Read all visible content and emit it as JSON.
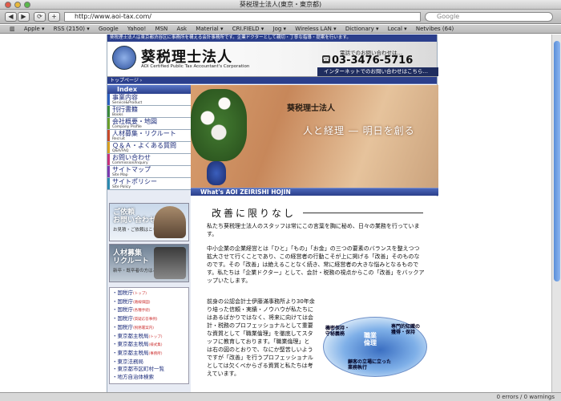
{
  "window": {
    "title": "葵税理士法人(東京・東京都)"
  },
  "toolbar": {
    "back_label": "◀",
    "forward_label": "▶",
    "refresh_label": "⟳",
    "add_label": "+",
    "url": "http://www.aoi-tax.com/",
    "search_placeholder": "Google"
  },
  "bookmarks": [
    "Apple ▾",
    "RSS (2150) ▾",
    "Google",
    "Yahoo!",
    "MSN",
    "Ask",
    "Material ▾",
    "CRI.FIELD ▾",
    "Jog ▾",
    "Wireless LAN ▾",
    "Dictionary ▾",
    "Local ▾",
    "Netvibes (64)"
  ],
  "site": {
    "topbar_text": "葵税理士法人は東京都渋谷区に事務所を構える会計事務所です。企業ドクターとして親切・丁寧な指導・提案を行います。",
    "logo_name": "葵税理士法人",
    "logo_sub": "AOI Certified Public Tax Accountant's Corporation",
    "phone_label": "電話でのお問い合わせは…",
    "phone_number": "03-3476-5716",
    "inquiry_text": "インターネットでのお問い合わせはこちら…",
    "breadcrumb": "トップページ ›",
    "index_label": "Index",
    "menu": [
      {
        "jp": "事業内容",
        "en": "Service&Product",
        "color": "#2b5fbf"
      },
      {
        "jp": "刊行書籍",
        "en": "Books",
        "color": "#3a8a3a"
      },
      {
        "jp": "会社概要・地図",
        "en": "Company Profile",
        "color": "#6a9e2a"
      },
      {
        "jp": "人材募集・リクルート",
        "en": "Recruit",
        "color": "#c84a2a"
      },
      {
        "jp": "Ｑ＆Ａ・よくある質問",
        "en": "Q&A/FAQ",
        "color": "#d8a020"
      },
      {
        "jp": "お問い合わせ",
        "en": "Commission/Inquiry",
        "color": "#c8307a"
      },
      {
        "jp": "サイトマップ",
        "en": "Site Map",
        "color": "#7a3ab0"
      },
      {
        "jp": "サイトポリシー",
        "en": "Site Policy",
        "color": "#2b8ab0"
      }
    ],
    "banner1": {
      "title_line1": "ご依頼",
      "title_line2": "お問い合わせ",
      "sub": "お見積・ご依頼はこちら"
    },
    "banner2": {
      "title_line1": "人材募集",
      "title_line2": "リクルート",
      "sub": "新卒・既卒者の方はこちら"
    },
    "links": [
      {
        "text": "・国税庁",
        "note": "(トップ)"
      },
      {
        "text": "・国税庁",
        "note": "(路線価図)"
      },
      {
        "text": "・国税庁",
        "note": "(各種手続)"
      },
      {
        "text": "・国税庁",
        "note": "(質疑応答事例)"
      },
      {
        "text": "・国税庁",
        "note": "(税務署案内)"
      },
      {
        "text": "・東京都主税局",
        "note": "(トップ)"
      },
      {
        "text": "・東京都主税局",
        "note": "(様式集)"
      },
      {
        "text": "・東京都主税局",
        "note": "(事務所)"
      },
      {
        "text": "・東京法務局",
        "note": ""
      },
      {
        "text": "・東京都市区町村一覧",
        "note": ""
      },
      {
        "text": "・地方自治体検索",
        "note": ""
      }
    ],
    "hero_sign": "葵税理士法人",
    "hero_slogan": "人と経理 ― 明日を創る",
    "what_label": "What's AOI ZEIRISHI HOJIN",
    "kaizen_heading": "改善に限りなし",
    "para1": "私たち葵税理士法人のスタッフは常にこの言葉を胸に秘め、日々の業務を行っています。",
    "para2": "中小企業の企業経営とは「ひと」「もの」「お金」の三つの要素のバランスを整えつつ拡大させて行くことであり、この経営者の行動こそが上に掲げる「改善」そのものなのです。その「改善」は絶えることなく続き、常に経営者の大きな悩みとなるものです。私たちは「企業ドクター」として、会計・税務の視点からこの「改善」をバックアップいたします。",
    "para3": "前身の公認会計士伊藤滿事務所より30年余り培った信頼・実績・ノウハウが私たちにはあるばかりではなく、将来に向けては会計・税務のプロフェッショナルとして重要な資質として「職業倫理」を徹底してスタッフに教育しております。「職業倫理」とは右の図のとおりで、なにか堅苦しいようですが「改善」を行うプロフェッショナルとしては欠くべからざる資質と私たちは考えています。",
    "diagram": {
      "center_line1": "職業",
      "center_line2": "倫理",
      "label_a": "機密保持・",
      "label_a2": "守秘義務",
      "label_b": "専門的知識の",
      "label_b2": "獲得・保持",
      "label_c": "顧客の立場に立った",
      "label_c2": "業務執行"
    }
  },
  "status": {
    "text": "0 errors / 0 warnings"
  }
}
